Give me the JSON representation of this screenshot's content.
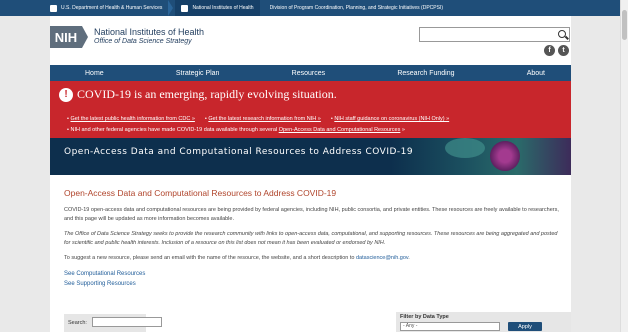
{
  "gov_bar": {
    "hhs": "U.S. Department of Health & Human Services",
    "nih": "National Institutes of Health",
    "division": "Division of Program Coordination, Planning, and Strategic Initiatives (DPCPSI)"
  },
  "header": {
    "logo_mark": "NIH",
    "logo_line1": "National Institutes of Health",
    "logo_line2": "Office of Data Science Strategy",
    "search_placeholder": "",
    "social": [
      "facebook-icon",
      "twitter-icon"
    ]
  },
  "nav": [
    "Home",
    "Strategic Plan",
    "Resources",
    "Research Funding",
    "About"
  ],
  "alert": {
    "title": "COVID-19 is an emerging, rapidly evolving situation.",
    "links": [
      "Get the latest public health information from CDC »",
      "Get the latest research information from NIH »",
      "NIH staff guidance on coronavirus (NIH Only) »"
    ],
    "line2_prefix": "NIH and other federal agencies have made COVID-19 data available through several ",
    "line2_link": "Open-Access Data and Computational Resources",
    "line2_suffix": " »"
  },
  "banner": {
    "title": "Open-Access Data and Computational Resources to Address COVID-19"
  },
  "content": {
    "heading": "Open-Access Data and Computational Resources to Address COVID-19",
    "p1": "COVID-19 open-access data and computational resources are being provided by federal agencies, including NIH, public consortia, and private entities. These resources are freely available to researchers, and this page will be updated as more information becomes available.",
    "p2": "The Office of Data Science Strategy seeks to provide the research community with links to open-access data, computational, and supporting resources. These resources are being aggregated and posted for scientific and public health interests. Inclusion of a resource on this list does not mean it has been evaluated or endorsed by NIH.",
    "p3_prefix": "To suggest a new resource, please send an email with the name of the resource, the website, and a short description to ",
    "p3_email": "datascience@nih.gov",
    "p3_suffix": ".",
    "link1": "See Computational Resources",
    "link2": "See Supporting Resources"
  },
  "filters": {
    "search_label": "Search:",
    "type_label": "Filter by Data Type",
    "type_selected": "- Any -",
    "apply_label": "Apply"
  }
}
